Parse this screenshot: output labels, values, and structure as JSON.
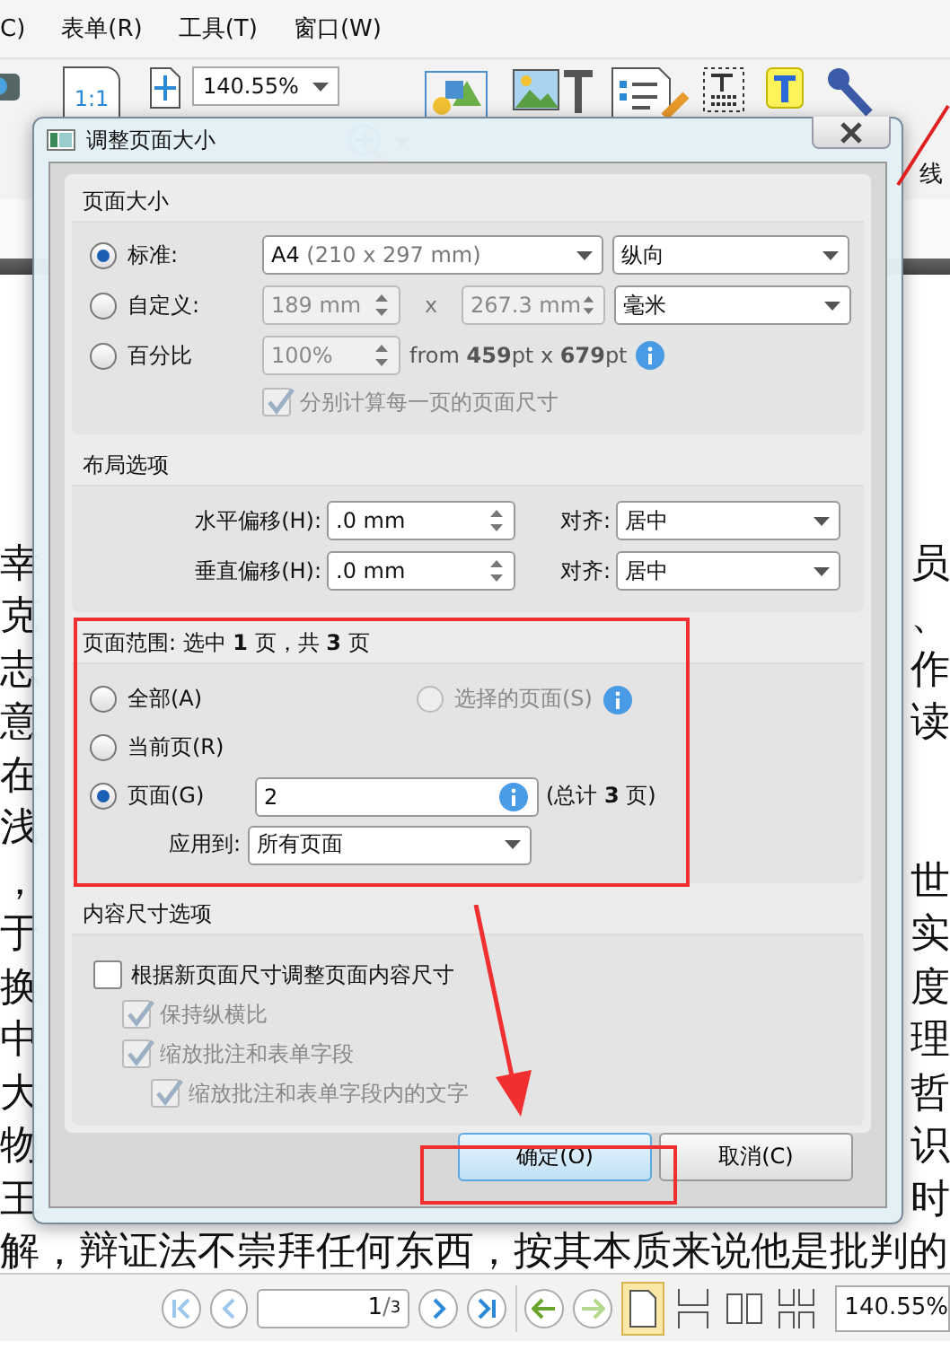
{
  "menu": [
    "C)",
    "表单(R)",
    "工具(T)",
    "窗口(W)"
  ],
  "toolbar": {
    "zoom": "140.55%",
    "actual_size": "1:1",
    "side_label": "线"
  },
  "document": {
    "lines": [
      {
        "left": "幸",
        "right": "员"
      },
      {
        "left": "克",
        "right": "、"
      },
      {
        "left": "志",
        "right": "作"
      },
      {
        "left": "意",
        "right": "读"
      },
      {
        "left": "在"
      },
      {
        "left": "浅"
      },
      {
        "left": "，",
        "right": "世"
      },
      {
        "left": "于",
        "right": "实"
      },
      {
        "left": "换",
        "right": "度"
      },
      {
        "left": "中",
        "right": "理"
      },
      {
        "left": "大",
        "right": "哲"
      },
      {
        "left": "物",
        "right": "识"
      },
      {
        "left": "王",
        "right": "时"
      },
      {
        "left": "解，辩证法不崇拜任何东西，按其本质来说他是批判的"
      }
    ]
  },
  "dialog": {
    "title": "调整页面大小",
    "page_size": {
      "heading": "页面大小",
      "options": [
        {
          "label": "标准:",
          "selected": true
        },
        {
          "label": "自定义:",
          "selected": false
        },
        {
          "label": "百分比",
          "selected": false
        }
      ],
      "standard_name": "A4",
      "standard_detail": "(210 x 297 mm)",
      "orientation": "纵向",
      "width": "189 mm",
      "times": "x",
      "height": "267.3 mm",
      "unit": "毫米",
      "percent": "100%",
      "from_text": "from **459**pt x **679**pt",
      "separate": {
        "label": "分别计算每一页的页面尺寸",
        "checked": true,
        "disabled": true
      }
    },
    "layout": {
      "heading": "布局选项",
      "rows": [
        {
          "label": "水平偏移(H):",
          "value": ".0 mm",
          "align_label": "对齐:",
          "align": "居中"
        },
        {
          "label": "垂直偏移(H):",
          "value": ".0 mm",
          "align_label": "对齐:",
          "align": "居中"
        }
      ]
    },
    "page_range": {
      "heading": "页面范围: 选中 **1** 页，共 **3** 页",
      "options": [
        {
          "label": "全部(A)",
          "selected": false,
          "disabled": false
        },
        {
          "label": "选择的页面(S)",
          "selected": false,
          "disabled": true
        },
        {
          "label": "当前页(R)",
          "selected": false,
          "disabled": false
        },
        {
          "label": "页面(G)",
          "selected": true,
          "disabled": false
        }
      ],
      "pages": "2",
      "total": "(总计 **3** 页)",
      "apply_label": "应用到:",
      "apply_value": "所有页面"
    },
    "content": {
      "heading": "内容尺寸选项",
      "checkboxes": [
        {
          "label": "根据新页面尺寸调整页面内容尺寸",
          "checked": false,
          "disabled": false,
          "children": [
            {
              "label": "保持纵横比",
              "checked": true,
              "disabled": true
            },
            {
              "label": "缩放批注和表单字段",
              "checked": true,
              "disabled": true,
              "children": [
                {
                  "label": "缩放批注和表单字段内的文字",
                  "checked": true,
                  "disabled": true
                }
              ]
            }
          ]
        }
      ]
    },
    "buttons": [
      {
        "label": "确定(O)",
        "default": true
      },
      {
        "label": "取消(C)",
        "default": false
      }
    ]
  },
  "nav": {
    "page": "1",
    "slash": "/",
    "total": "3",
    "zoom": "140.55%"
  }
}
